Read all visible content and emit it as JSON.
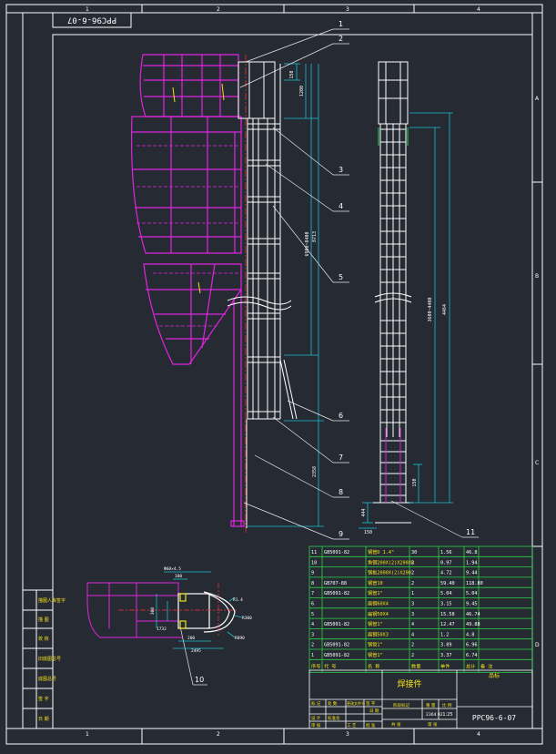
{
  "colors": {
    "background": "#262a33",
    "frame": "#ffffff",
    "structure": "#e024e0",
    "ladder": "#ffffff",
    "dimension": "#19c2d2",
    "leader": "#e8e8e8",
    "red": "#ff3030",
    "yellow": "#f2e21a",
    "green": "#2fd24a"
  },
  "drawing_number_rotated": "PPC96-6-07",
  "grid": {
    "columns": [
      "1",
      "2",
      "3",
      "4"
    ],
    "rows": [
      "A",
      "B",
      "C",
      "D"
    ]
  },
  "leaders": [
    "1",
    "2",
    "3",
    "4",
    "5",
    "6",
    "7",
    "8",
    "9",
    "10",
    "11"
  ],
  "dims": {
    "main_d1": "150",
    "main_d2": "1200",
    "main_d3": "6900~8400",
    "main_d4": "8713",
    "main_d5": "2358",
    "side_d1": "3600~4400",
    "side_d2": "4464",
    "side_d3": "150",
    "side_d4": "444",
    "side_d5": "150",
    "det_d1": "Φ60×4.5",
    "det_d2": "180",
    "det_d3": "300",
    "det_d4": "1732",
    "det_d5": "R1.4",
    "det_d6": "R300",
    "det_d7": "200",
    "det_d8": "2495",
    "det_d9": "R890"
  },
  "left_block": [
    "描图人库签字",
    "描 图",
    "校 核",
    "旧底图总号",
    "底图总号",
    "签 字",
    "日 期"
  ],
  "bom": [
    {
      "no": "11",
      "code": "GB5091-82",
      "name": "钢管D 1.4\"",
      "qty": "30",
      "unit": "1.56",
      "total": "46.8"
    },
    {
      "no": "10",
      "code": "",
      "name": "角钢200X(2)X200X8",
      "qty": "2",
      "unit": "0.97",
      "total": "1.94"
    },
    {
      "no": "9",
      "code": "",
      "name": "钢板2000X(2)X200",
      "qty": "2",
      "unit": "4.72",
      "total": "9.44"
    },
    {
      "no": "8",
      "code": "GB707-88",
      "name": "钢管10",
      "qty": "2",
      "unit": "59.40",
      "total": "118.80"
    },
    {
      "no": "7",
      "code": "GB5091-82",
      "name": "钢管1\"",
      "qty": "1",
      "unit": "5.04",
      "total": "5.04"
    },
    {
      "no": "6",
      "code": "",
      "name": "扁钢60X4",
      "qty": "3",
      "unit": "3.15",
      "total": "9.45"
    },
    {
      "no": "5",
      "code": "",
      "name": "扁钢50X4",
      "qty": "3",
      "unit": "15.58",
      "total": "46.74"
    },
    {
      "no": "4",
      "code": "GB5091-82",
      "name": "钢管1\"",
      "qty": "4",
      "unit": "12.47",
      "total": "49.88"
    },
    {
      "no": "3",
      "code": "",
      "name": "扁钢50X3",
      "qty": "4",
      "unit": "1.2",
      "total": "4.8"
    },
    {
      "no": "2",
      "code": "GB5091-82",
      "name": "钢管1\"",
      "qty": "2",
      "unit": "3.89",
      "total": "6.96"
    },
    {
      "no": "1",
      "code": "GB5091-82",
      "name": "钢管1\"",
      "qty": "2",
      "unit": "3.37",
      "total": "6.74"
    }
  ],
  "bom_header": [
    "序号",
    "代 号",
    "名 称",
    "数量",
    "单件",
    "总计",
    "备 注"
  ],
  "title_block": {
    "part_name": "焊接件",
    "org": "品标",
    "drawing_no": "PPC96-6-07",
    "ratio": "1:25",
    "cells": [
      "标 记",
      "处 数",
      "更改文件号",
      "签 字",
      "日 期",
      "阶段标记",
      "重 量",
      "比 例",
      "共 张",
      "第 张",
      "设 计",
      "标准化",
      "审 核",
      "工 艺",
      "批 准",
      "2364.92"
    ]
  }
}
